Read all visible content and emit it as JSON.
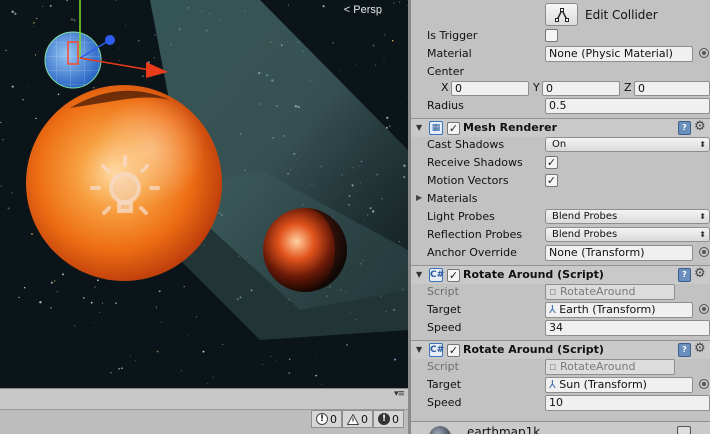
{
  "scene": {
    "projection_label": "< Persp"
  },
  "console": {
    "menu_glyph": "▾≡",
    "info_count": "0",
    "warning_count": "0",
    "error_count": "0"
  },
  "inspector": {
    "edit_collider_label": "Edit Collider",
    "sphere_collider": {
      "is_trigger_label": "Is Trigger",
      "is_trigger_checked": false,
      "material_label": "Material",
      "material_value": "None (Physic Material)",
      "center_label": "Center",
      "center_x_label": "X",
      "center_x": "0",
      "center_y_label": "Y",
      "center_y": "0",
      "center_z_label": "Z",
      "center_z": "0",
      "radius_label": "Radius",
      "radius_value": "0.5"
    },
    "mesh_renderer": {
      "title": "Mesh Renderer",
      "enabled": true,
      "cast_shadows_label": "Cast Shadows",
      "cast_shadows_value": "On",
      "receive_shadows_label": "Receive Shadows",
      "receive_shadows_checked": true,
      "motion_vectors_label": "Motion Vectors",
      "motion_vectors_checked": true,
      "materials_label": "Materials",
      "light_probes_label": "Light Probes",
      "light_probes_value": "Blend Probes",
      "reflection_probes_label": "Reflection Probes",
      "reflection_probes_value": "Blend Probes",
      "anchor_override_label": "Anchor Override",
      "anchor_override_value": "None (Transform)"
    },
    "rotate_around_1": {
      "title": "Rotate Around (Script)",
      "enabled": true,
      "script_label": "Script",
      "script_value": "RotateAround",
      "target_label": "Target",
      "target_value": "Earth (Transform)",
      "speed_label": "Speed",
      "speed_value": "34"
    },
    "rotate_around_2": {
      "title": "Rotate Around (Script)",
      "enabled": true,
      "script_label": "Script",
      "script_value": "RotateAround",
      "target_label": "Target",
      "target_value": "Sun (Transform)",
      "speed_label": "Speed",
      "speed_value": "10"
    },
    "asset_preview": {
      "name": "earthmap1k"
    }
  },
  "colors": {
    "inspector_bg": "#c2c2c2",
    "scene_bg": "#0b1317",
    "sun_orange": "#f07a1a",
    "gizmo_x": "#e83b1c",
    "gizmo_y": "#7ddc2b",
    "gizmo_z": "#2f5cf0"
  }
}
